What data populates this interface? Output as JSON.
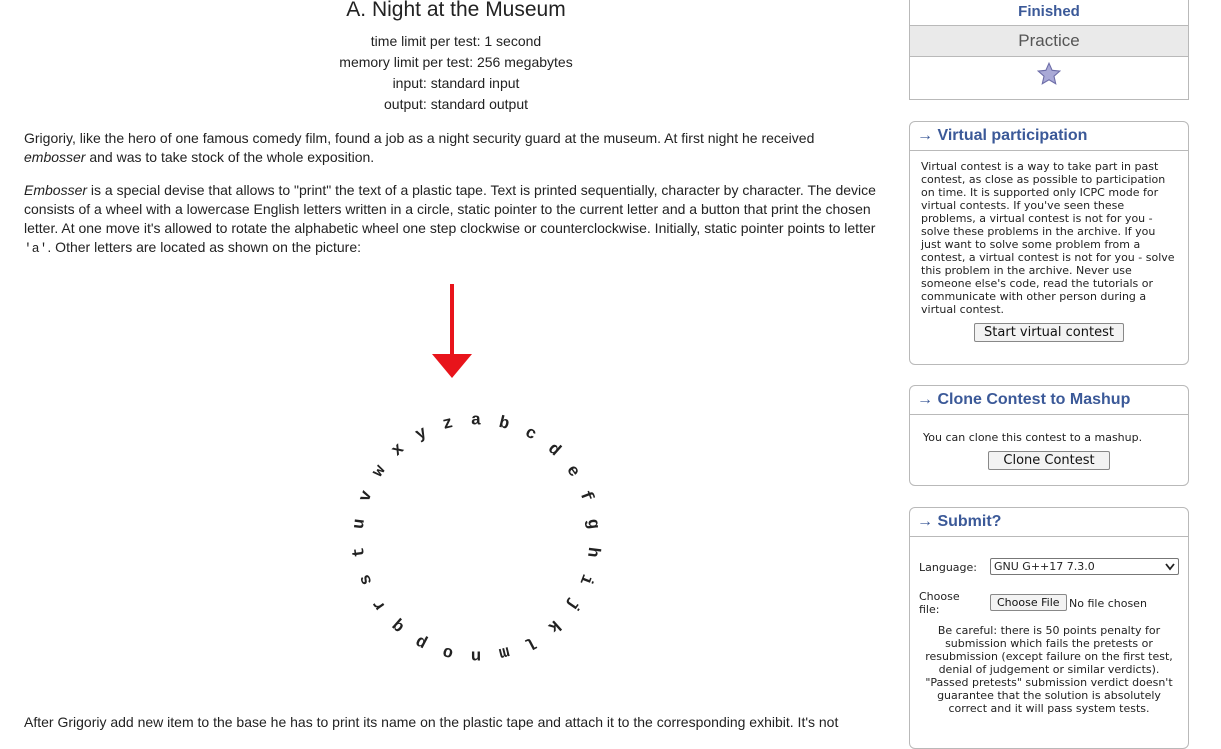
{
  "problem": {
    "title": "A. Night at the Museum",
    "specs": [
      "time limit per test: 1 second",
      "memory limit per test: 256 megabytes",
      "input: standard input",
      "output: standard output"
    ],
    "para1_a": "Grigoriy, like the hero of one famous comedy film, found a job as a night security guard at the museum. At first night he received",
    "para1_em": "embosser",
    "para1_b": " and was to take stock of the whole exposition.",
    "para2_em": "Embosser",
    "para2_a": " is a special devise that allows to \"print\" the text of a plastic tape. Text is printed sequentially, character by character. The device consists of a wheel with a lowercase English letters written in a circle, static pointer to the current letter and a button that print the chosen letter. At one move it's allowed to rotate the alphabetic wheel one step clockwise or counterclockwise. Initially, static pointer points to letter ",
    "para2_code": "'a'",
    "para2_b": ". Other letters are located as shown on the picture:",
    "para3": "After Grigoriy add new item to the base he has to print its name on the plastic tape and attach it to the corresponding exhibit. It's not",
    "wheel_letters": [
      "a",
      "b",
      "c",
      "d",
      "e",
      "f",
      "g",
      "h",
      "i",
      "j",
      "k",
      "l",
      "m",
      "n",
      "o",
      "p",
      "q",
      "r",
      "s",
      "t",
      "u",
      "v",
      "w",
      "x",
      "y",
      "z"
    ]
  },
  "sidebar": {
    "status": "Finished",
    "mode": "Practice",
    "star_icon": "star-icon",
    "virtual": {
      "title": "Virtual participation",
      "arrow": "→",
      "text": "Virtual contest is a way to take part in past contest, as close as possible to participation on time. It is supported only ICPC mode for virtual contests. If you've seen these problems, a virtual contest is not for you - solve these problems in the archive. If you just want to solve some problem from a contest, a virtual contest is not for you - solve this problem in the archive. Never use someone else's code, read the tutorials or communicate with other person during a virtual contest.",
      "button": "Start virtual contest"
    },
    "clone": {
      "title": "Clone Contest to Mashup",
      "arrow": "→",
      "text": "You can clone this contest to a mashup.",
      "button": "Clone Contest"
    },
    "submit": {
      "title": "Submit?",
      "arrow": "→",
      "language_label": "Language:",
      "language_value": "GNU G++17 7.3.0",
      "file_label": "Choose file:",
      "file_button": "Choose File",
      "file_status": "No file chosen",
      "warning": "Be careful: there is 50 points penalty for submission which fails the pretests or resubmission (except failure on the first test, denial of judgement or similar verdicts). \"Passed pretests\" submission verdict doesn't guarantee that the solution is absolutely correct and it will pass system tests."
    }
  },
  "colors": {
    "link": "#3b5998",
    "pointer": "#e8141b",
    "border": "#b9b9b9"
  }
}
